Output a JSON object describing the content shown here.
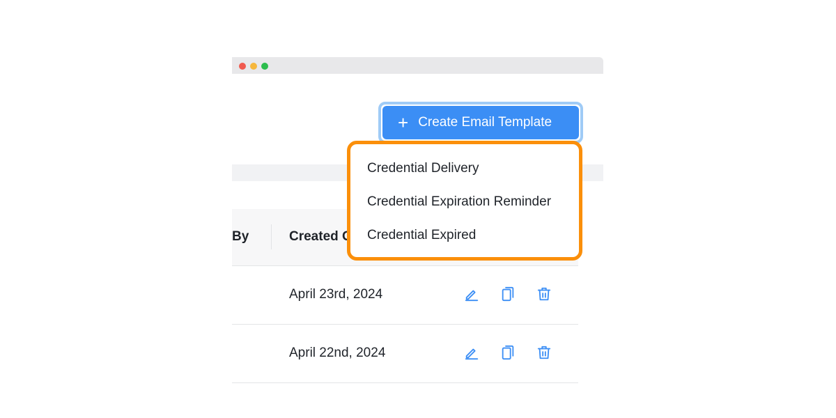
{
  "window": {
    "controls": [
      "close",
      "minimize",
      "maximize"
    ]
  },
  "toolbar": {
    "create_label": "Create Email Template",
    "create_icon": "plus-icon"
  },
  "dropdown": {
    "items": [
      {
        "label": "Credential Delivery"
      },
      {
        "label": "Credential Expiration Reminder"
      },
      {
        "label": "Credential Expired"
      }
    ]
  },
  "table": {
    "columns": [
      "By",
      "Created O"
    ],
    "rows": [
      {
        "created_on": "April 23rd, 2024",
        "actions": [
          "edit-icon",
          "copy-icon",
          "trash-icon"
        ]
      },
      {
        "created_on": "April 22nd, 2024",
        "actions": [
          "edit-icon",
          "copy-icon",
          "trash-icon"
        ]
      }
    ]
  },
  "colors": {
    "primary": "#3b8ef5",
    "primary_focus_ring": "#9fcbf6",
    "dropdown_highlight": "#fb8f0a",
    "icon_blue": "#3b8ef5"
  }
}
